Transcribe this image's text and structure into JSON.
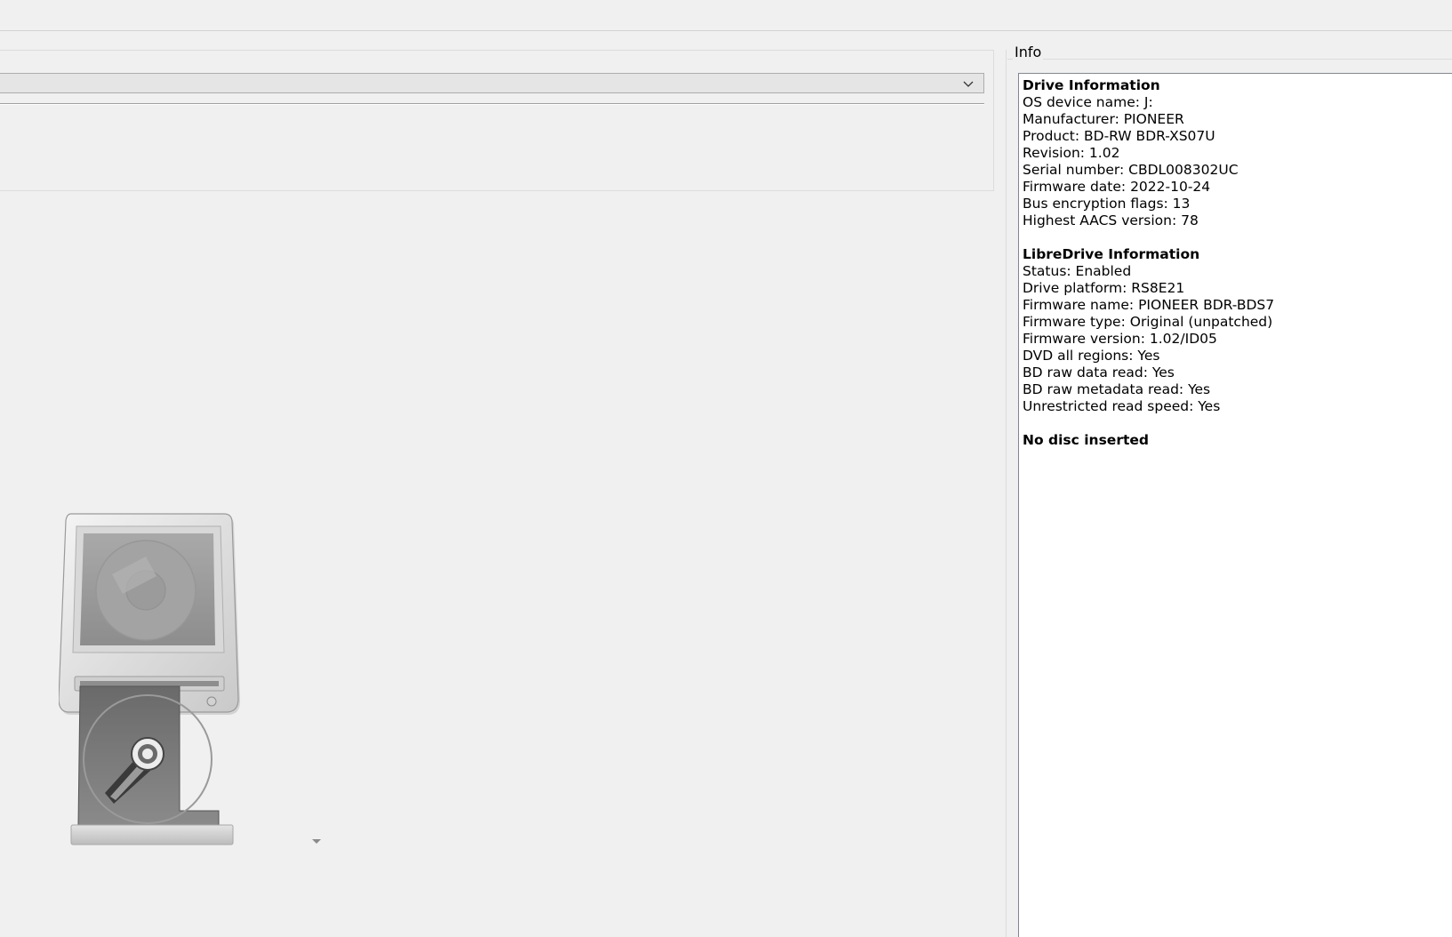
{
  "info_panel": {
    "caption": "Info",
    "drive_information": {
      "heading": "Drive Information",
      "lines": [
        "OS device name: J:",
        "Manufacturer: PIONEER",
        "Product: BD-RW BDR-XS07U",
        "Revision: 1.02",
        "Serial number: CBDL008302UC",
        "Firmware date: 2022-10-24",
        "Bus encryption flags: 13",
        "Highest AACS version: 78"
      ]
    },
    "libredrive_information": {
      "heading": "LibreDrive Information",
      "lines": [
        "Status: Enabled",
        "Drive platform: RS8E21",
        "Firmware name: PIONEER BDR-BDS7",
        "Firmware type: Original (unpatched)",
        "Firmware version: 1.02/ID05",
        "DVD all regions: Yes",
        "BD raw data read: Yes",
        "BD raw metadata read: Yes",
        "Unrestricted read speed: Yes"
      ]
    },
    "disc_status": "No disc inserted"
  },
  "drive_selector": {
    "value": "",
    "icon": "chevron-down-icon"
  },
  "drive_graphic": {
    "icon": "optical-drive-open-tray-icon"
  },
  "colors": {
    "window_bg": "#f0f0f0",
    "info_bg": "#ffffff",
    "border": "#828790"
  }
}
